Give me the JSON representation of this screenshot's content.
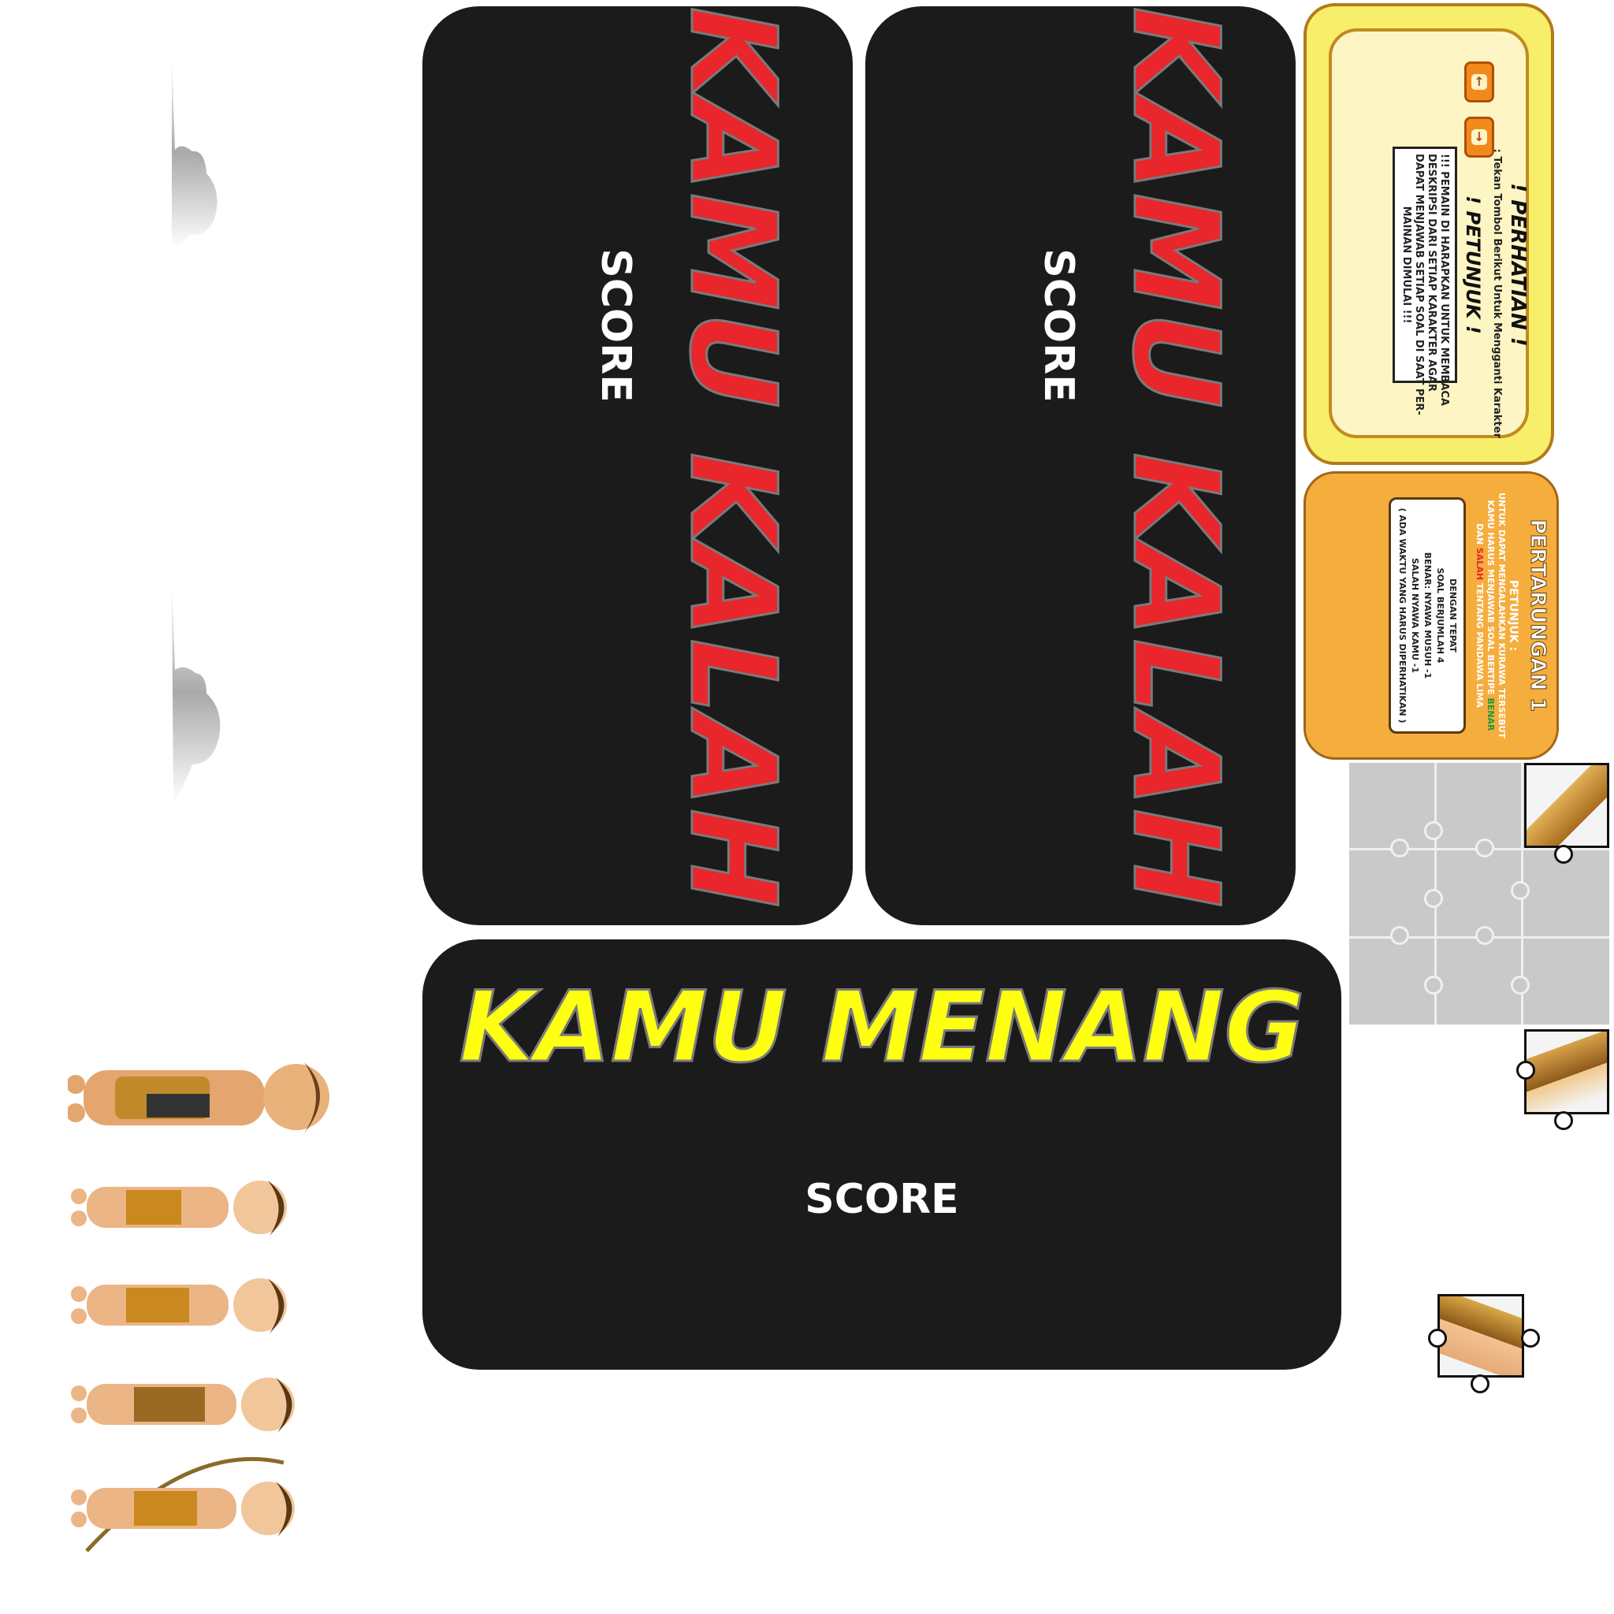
{
  "lose_cards": [
    {
      "title": "KAMU KALAH",
      "score_label": "SCORE"
    },
    {
      "title": "KAMU KALAH",
      "score_label": "SCORE"
    }
  ],
  "win_card": {
    "title": "KAMU MENANG",
    "score_label": "SCORE"
  },
  "notice_panel": {
    "heading": "! PERHATIAN !",
    "key_hint": ": Tekan Tombol Berikut Untuk Mengganti Karakter",
    "guide_heading": "! PETUNJUK !",
    "guide_text": [
      "!!! PEMAIN DI HARAPKAN UNTUK MEMBACA",
      "DESKRIPSI DARI SETIAP KARAKTER AGAR",
      "DAPAT MENJAWAB SETIAP SOAL DI SAAT PER-",
      "MAINAN DIMULAI !!!"
    ]
  },
  "battle_panel": {
    "title": "PERTARUNGAN 1",
    "guide_heading": "PETUNJUK :",
    "lines": [
      "UNTUK DAPAT MENGALAHKAN KURAWA TERSEBUT",
      "KAMU HARUS MENJAWAB SOAL BERTIPE",
      "BENAR",
      "DAN",
      "SALAH",
      "TENTANG PANDAWA LIMA",
      "DENGAN TEPAT"
    ],
    "rules": [
      "SOAL BERJUMLAH 4",
      "BENAR: NYAWA MUSUH -1",
      "SALAH NYAWA KAMU -1",
      "( ADA WAKTU YANG HARUS DIPERHATIKAN )"
    ],
    "colors": {
      "benar": "#1f9a3a",
      "salah": "#e8262b"
    }
  },
  "colors": {
    "card_bg": "#1b1b1b",
    "lose_text": "#e8262b",
    "win_text": "#ffff12"
  },
  "icons": [
    "arrow-up-icon",
    "arrow-down-icon",
    "puzzle-piece-icon",
    "character-sprite-icon",
    "cloud-icon"
  ]
}
